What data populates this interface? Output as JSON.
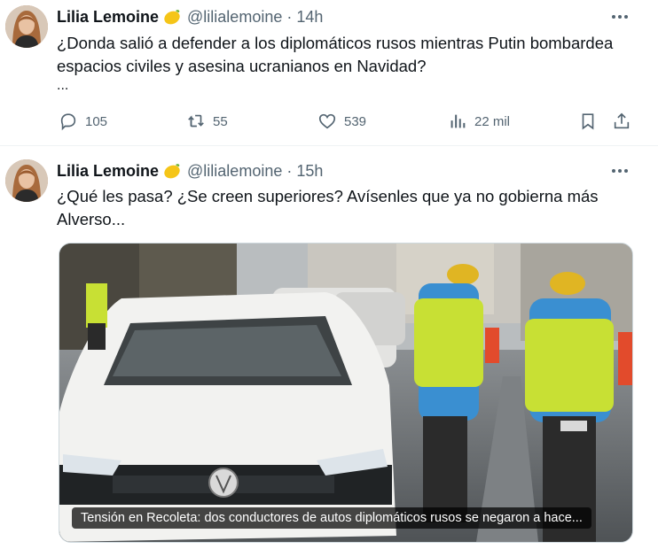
{
  "tweets": [
    {
      "name": "Lilia Lemoine",
      "emoji": "lemon",
      "handle": "@lilialemoine",
      "separator": "·",
      "time": "14h",
      "text": "¿Donda salió a defender a los diplomáticos rusos mientras Putin bombardea espacios civiles y asesina ucranianos en Navidad?",
      "more_text": "...",
      "stats": {
        "replies": "105",
        "retweets": "55",
        "likes": "539",
        "views": "22 mil"
      }
    },
    {
      "name": "Lilia Lemoine",
      "emoji": "lemon",
      "handle": "@lilialemoine",
      "separator": "·",
      "time": "15h",
      "text": "¿Qué les pasa? ¿Se creen superiores? Avísenles que ya no gobierna más Alverso...",
      "media_caption": "Tensión en Recoleta: dos conductores de autos diplomáticos rusos se negaron a hace..."
    }
  ],
  "icons": [
    "more-icon",
    "reply-icon",
    "retweet-icon",
    "like-icon",
    "views-icon",
    "bookmark-icon",
    "share-icon"
  ],
  "colors": {
    "text": "#0f1419",
    "secondary": "#536471",
    "divider": "#eff3f4",
    "vest": "#c8e034",
    "vest_blue": "#3a8fd1"
  }
}
